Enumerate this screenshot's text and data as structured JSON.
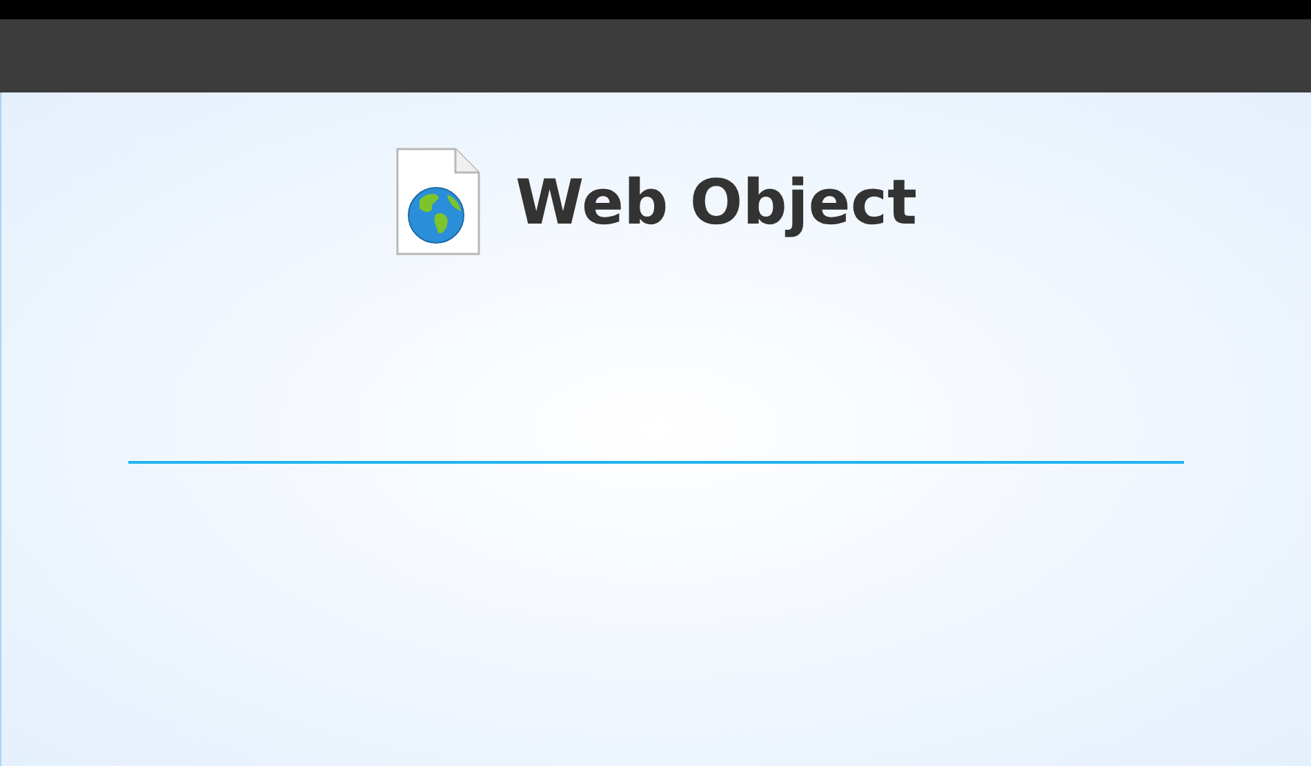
{
  "header": {
    "title": "Web Object"
  }
}
